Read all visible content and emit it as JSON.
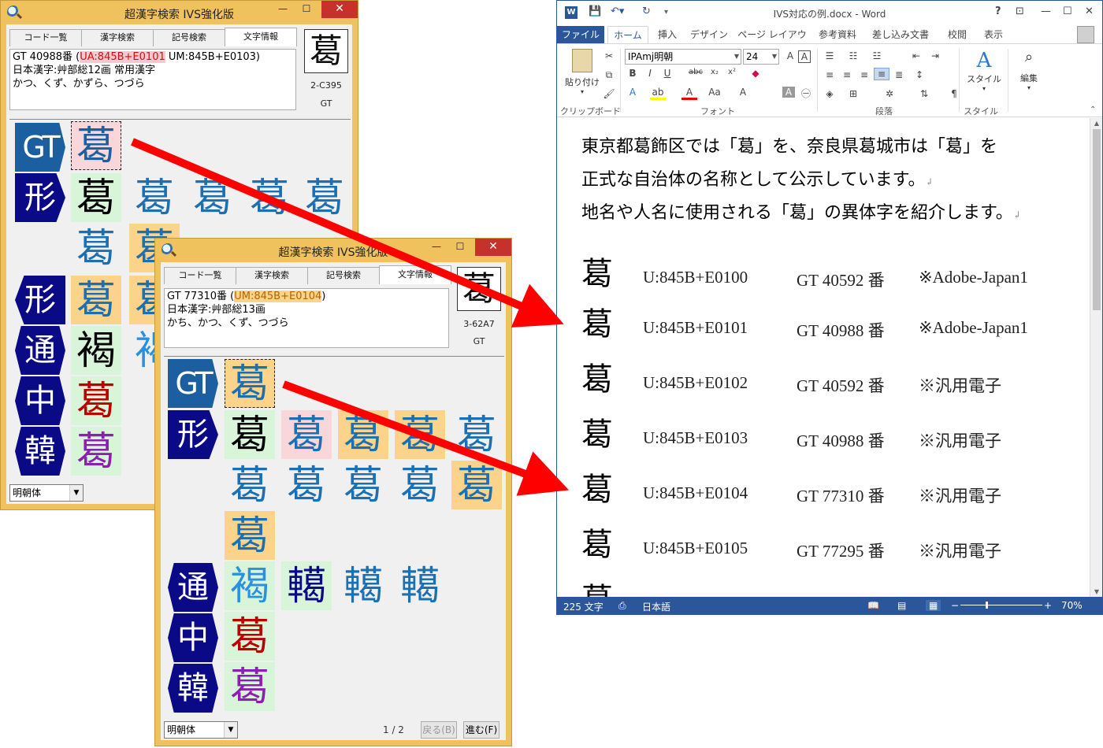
{
  "kanji_window_1": {
    "title": "超漢字検索 IVS強化版",
    "tabs": [
      "コード一覧",
      "漢字検索",
      "記号検索",
      "文字情報"
    ],
    "info_line1_pre": "GT 40988番 (",
    "info_line1_hl": "UA:845B+E0101",
    "info_line1_post": " UM:845B+E0103)",
    "info_line2": "日本漢字:艸部総12画 常用漢字",
    "info_line3": "かつ、くず、かずら、つづら",
    "big_char": "葛",
    "code_label": "2-C395",
    "gt_label": "GT",
    "badges": [
      "GT",
      "形",
      "形",
      "通",
      "中",
      "韓"
    ],
    "glyphs": {
      "g1": "葛",
      "g2": "葛",
      "g3": "葛",
      "g4": "葛",
      "g5": "葛",
      "g6": "葛",
      "g7": "葛",
      "g8": "葛",
      "g9": "葛",
      "g10": "葛",
      "g11": "葛",
      "g12": "葛",
      "g13": "褐",
      "g14": "褐",
      "g15": "葛",
      "g16": "葛"
    },
    "font_select": "明朝体"
  },
  "kanji_window_2": {
    "title": "超漢字検索 IVS強化版",
    "tabs": [
      "コード一覧",
      "漢字検索",
      "記号検索",
      "文字情報"
    ],
    "info_line1_pre": "GT 77310番 (",
    "info_line1_hl": "UM:845B+E0104",
    "info_line1_post": ")",
    "info_line2": "日本漢字:艸部総13画",
    "info_line3": "かち、かつ、くず、つづら",
    "big_char": "葛",
    "code_label": "3-62A7",
    "gt_label": "GT",
    "badges": [
      "GT",
      "形",
      "通",
      "中",
      "韓"
    ],
    "glyphs": {
      "h1": "葛",
      "h2": "葛",
      "h3": "葛",
      "h4": "葛",
      "h5": "葛",
      "h6": "葛",
      "h7": "葛",
      "h8": "葛",
      "h9": "葛",
      "h10": "葛",
      "h11": "葛",
      "h12": "葛",
      "h13": "褐",
      "h14": "轕",
      "h15": "轕",
      "h16": "轕",
      "h17": "葛",
      "h18": "葛"
    },
    "font_select": "明朝体",
    "pager": "1 / 2",
    "back_button": "戻る(B)",
    "next_button": "進む(F)"
  },
  "word": {
    "title": "IVS対応の例.docx - Word",
    "help": "?",
    "ribbon_tabs": [
      "ファイル",
      "ホーム",
      "挿入",
      "デザイン",
      "ページ レイアウト",
      "参考資料",
      "差し込み文書",
      "校閲",
      "表示"
    ],
    "font_name": "IPAmj明朝",
    "font_size": "24",
    "paste_label": "貼り付け",
    "style_label": "スタイル",
    "edit_label": "編集",
    "groups": [
      "クリップボード",
      "フォント",
      "段落",
      "スタイル"
    ],
    "para1": "東京都葛飾区では「葛」を、奈良県葛城市は「葛」を",
    "para2": "正式な自治体の名称として公示しています。",
    "para3": "地名や人名に使用される「葛」の異体字を紹介します。",
    "rows": [
      {
        "k": "葛",
        "u": "U:845B+E0100",
        "g": "GT 40592 番",
        "n": "※Adobe-Japan1"
      },
      {
        "k": "葛",
        "u": "U:845B+E0101",
        "g": "GT 40988 番",
        "n": "※Adobe-Japan1"
      },
      {
        "k": "葛",
        "u": "U:845B+E0102",
        "g": "GT 40592 番",
        "n": "※汎用電子"
      },
      {
        "k": "葛",
        "u": "U:845B+E0103",
        "g": "GT 40988 番",
        "n": "※汎用電子"
      },
      {
        "k": "葛",
        "u": "U:845B+E0104",
        "g": "GT 77310 番",
        "n": "※汎用電子"
      },
      {
        "k": "葛",
        "u": "U:845B+E0105",
        "g": "GT 77295 番",
        "n": "※汎用電子"
      }
    ],
    "partial_row": "葛",
    "status_words": "225 文字",
    "status_lang": "日本語",
    "zoom": "70%"
  },
  "colors": {
    "kanji_window_bg": "#f0c25e",
    "word_accent": "#2b579a",
    "arrow": "#ff0000"
  }
}
